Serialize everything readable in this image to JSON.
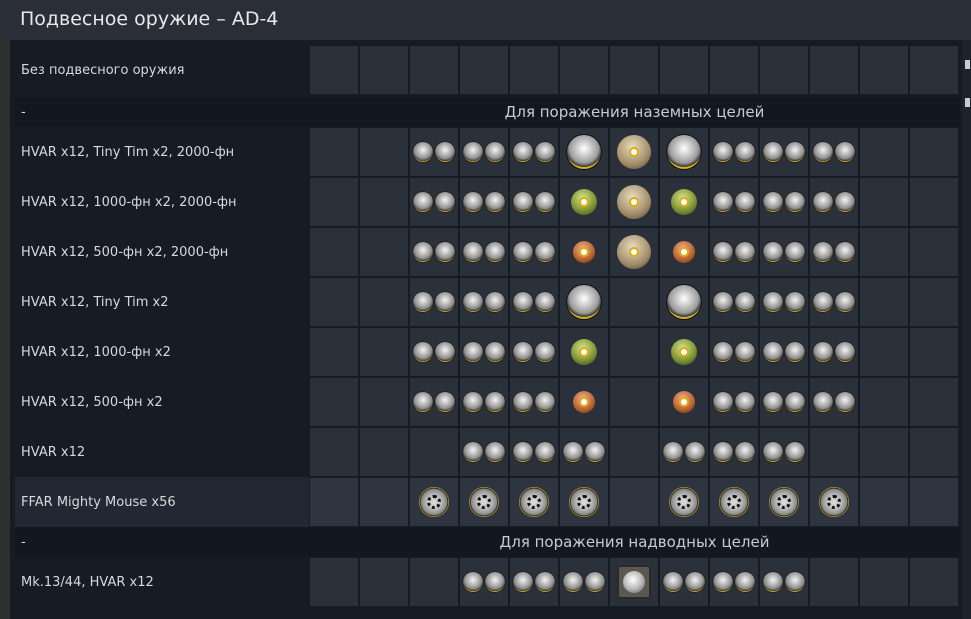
{
  "title": "Подвесное оружие – AD-4",
  "sections": [
    {
      "dash": "-",
      "heading": "Для поражения наземных целей"
    },
    {
      "dash": "-",
      "heading": "Для поражения надводных целей"
    }
  ],
  "rows": [
    {
      "label": "Без подвесного оружия",
      "slots": [
        "",
        "",
        "",
        "",
        "",
        "",
        "",
        "",
        "",
        "",
        "",
        "",
        ""
      ]
    },
    {
      "label": "HVAR x12,  Tiny Tim x2,  2000-фн",
      "slots": [
        "",
        "",
        "hvar2",
        "hvar2",
        "hvar2",
        "tinytim",
        "bomb2000",
        "tinytim",
        "hvar2",
        "hvar2",
        "hvar2",
        "",
        ""
      ]
    },
    {
      "label": "HVAR x12,  1000-фн x2,  2000-фн",
      "slots": [
        "",
        "",
        "hvar2",
        "hvar2",
        "hvar2",
        "bomb1000",
        "bomb2000",
        "bomb1000",
        "hvar2",
        "hvar2",
        "hvar2",
        "",
        ""
      ]
    },
    {
      "label": "HVAR x12,  500-фн x2,  2000-фн",
      "slots": [
        "",
        "",
        "hvar2",
        "hvar2",
        "hvar2",
        "bomb500",
        "bomb2000",
        "bomb500",
        "hvar2",
        "hvar2",
        "hvar2",
        "",
        ""
      ]
    },
    {
      "label": "HVAR x12,  Tiny Tim x2",
      "slots": [
        "",
        "",
        "hvar2",
        "hvar2",
        "hvar2",
        "tinytim",
        "",
        "tinytim",
        "hvar2",
        "hvar2",
        "hvar2",
        "",
        ""
      ]
    },
    {
      "label": "HVAR x12,  1000-фн x2",
      "slots": [
        "",
        "",
        "hvar2",
        "hvar2",
        "hvar2",
        "bomb1000",
        "",
        "bomb1000",
        "hvar2",
        "hvar2",
        "hvar2",
        "",
        ""
      ]
    },
    {
      "label": "HVAR x12,  500-фн x2",
      "slots": [
        "",
        "",
        "hvar2",
        "hvar2",
        "hvar2",
        "bomb500",
        "",
        "bomb500",
        "hvar2",
        "hvar2",
        "hvar2",
        "",
        ""
      ]
    },
    {
      "label": "HVAR x12",
      "slots": [
        "",
        "",
        "",
        "hvar2",
        "hvar2",
        "hvar2",
        "",
        "hvar2",
        "hvar2",
        "hvar2",
        "",
        "",
        ""
      ]
    },
    {
      "label": "FFAR Mighty Mouse x56",
      "highlighted": true,
      "slots": [
        "",
        "",
        "ffar",
        "ffar",
        "ffar",
        "ffar",
        "",
        "ffar",
        "ffar",
        "ffar",
        "ffar",
        "",
        ""
      ]
    },
    {
      "label": "Mk.13/44,  HVAR x12",
      "slots": [
        "",
        "",
        "",
        "hvar2",
        "hvar2",
        "hvar2",
        "torpedo",
        "hvar2",
        "hvar2",
        "hvar2",
        "",
        "",
        ""
      ]
    }
  ]
}
